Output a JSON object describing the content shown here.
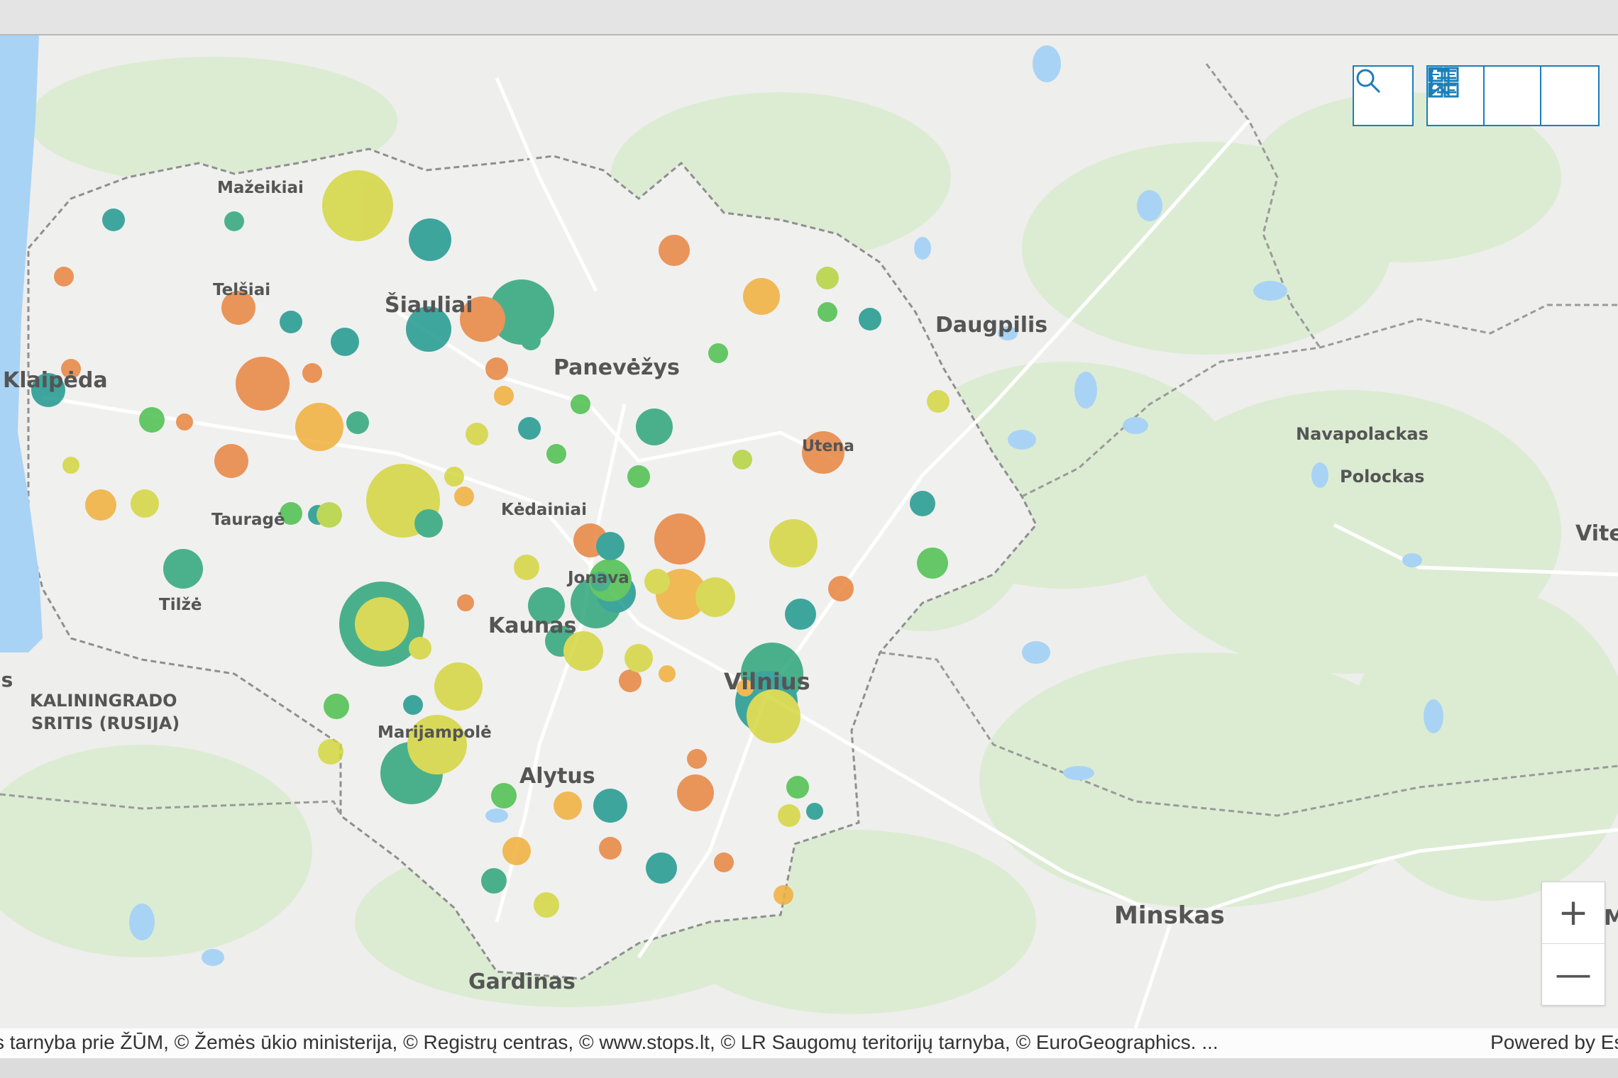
{
  "toolbar": {
    "search_icon": "search-icon",
    "bookmarks_icon": "bookmark-icon",
    "legend_icon": "list-icon",
    "basemap_icon": "basemap-gallery-icon"
  },
  "zoom": {
    "in_label": "+",
    "out_label": "—"
  },
  "attribution": {
    "text": "s tarnyba prie ŽŪM, © Žemės ūkio ministerija, © Registrų centras, © www.stops.lt, © LR Saugomų teritorijų tarnyba, © EuroGeographics. ...",
    "powered": "Powered by Esri"
  },
  "map": {
    "place_labels": [
      {
        "text": "Mažeikiai"
      },
      {
        "text": "Telšiai"
      },
      {
        "text": "Šiauliai"
      },
      {
        "text": "Panevėžys"
      },
      {
        "text": "Klaipėda"
      },
      {
        "text": "Utena"
      },
      {
        "text": "Daugpilis"
      },
      {
        "text": "Navapolackas"
      },
      {
        "text": "Polockas"
      },
      {
        "text": "Vite"
      },
      {
        "text": "Kėdainiai"
      },
      {
        "text": "Tauragė"
      },
      {
        "text": "Jonava"
      },
      {
        "text": "Tilžė"
      },
      {
        "text": "Kaunas"
      },
      {
        "text": "Vilnius"
      },
      {
        "text": "KALININGRADO"
      },
      {
        "text": "SRITIS (RUSIJA)"
      },
      {
        "text": "Marijampolė"
      },
      {
        "text": "Alytus"
      },
      {
        "text": "Minskas"
      },
      {
        "text": "Gardinas"
      },
      {
        "text": "Mo"
      },
      {
        "text": "ls"
      }
    ],
    "colors": {
      "water": "#a9d3f5",
      "land": "#eeeeec",
      "forest": "#dcecd3",
      "border": "#8f8f8f",
      "roads": "#ffffff",
      "accent": "#1a7fb8"
    }
  }
}
